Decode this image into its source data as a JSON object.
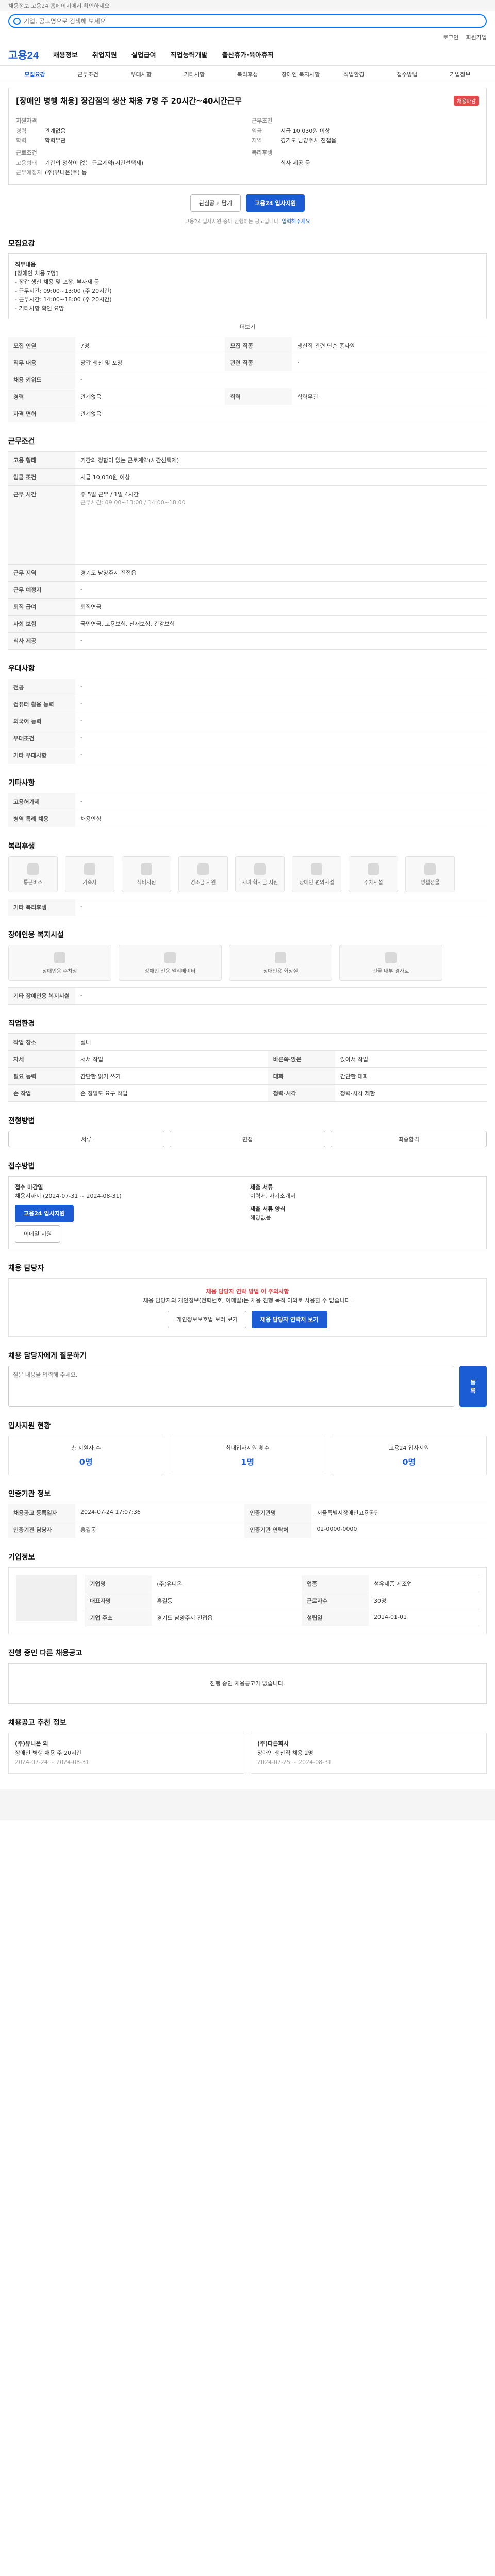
{
  "util": {
    "top": "채용정보 고용24 홈페이지에서 확인하세요",
    "login": "로그인",
    "join": "회원가입"
  },
  "search": {
    "placeholder": "기업, 공고명으로 검색해 보세요"
  },
  "gnb": {
    "logo": "고용24",
    "items": [
      "채용정보",
      "취업지원",
      "실업급여",
      "직업능력개발",
      "출산휴가·육아휴직"
    ]
  },
  "tabs": [
    "모집요강",
    "근무조건",
    "우대사항",
    "기타사항",
    "복리후생",
    "장애인 복지사항",
    "직업환경",
    "접수방법",
    "기업정보"
  ],
  "job": {
    "title": "[장애인 병행 채용] 장갑점의 생산 채용 7명 주 20시간~40시간근무",
    "badge": "채용마감",
    "left_label": "지원자격",
    "left": [
      [
        "경력",
        "관계없음"
      ],
      [
        "학력",
        "학력무관"
      ]
    ],
    "left2_label": "근로조건",
    "left2": [
      [
        "고용형태",
        "기간의 정함이 없는 근로계약(시간선택제)"
      ],
      [
        "근무예정지",
        "(주)유니온(주) 등"
      ]
    ],
    "right_label": "근무조건",
    "right": [
      [
        "임금",
        "시급 10,030원 이상"
      ],
      [
        "지역",
        "경기도 남양주시 진접읍"
      ]
    ],
    "right2_label": "복리후생",
    "right2": [
      [
        "",
        "식사 제공 등"
      ]
    ],
    "btn_like": "관심공고 담기",
    "btn_apply": "고용24 입사지원",
    "note": "고용24 입사지원 중이 진행하는 공고입니다.",
    "note_link": "입력해주세요"
  },
  "sec1": {
    "title": "모집요강",
    "desc_title": "직무내용",
    "desc": [
      "[장애인 채용 7명]",
      "- 장갑 생산 채용 및 포장, 부자재 등",
      "- 근무시간: 09:00~13:00 (주 20시간)",
      "- 근무시간: 14:00~18:00 (주 20시간)",
      "- 기타사항 확인 요망"
    ],
    "more": "더보기",
    "rows": [
      [
        "모집 인원",
        "7명",
        "모집 직종",
        "생산직 관련 단순 종사원"
      ],
      [
        "직무 내용",
        "장갑 생산 및 포장",
        "관련 직종",
        "-"
      ],
      [
        "채용 키워드",
        "-",
        "",
        ""
      ],
      [
        "경력",
        "관계없음",
        "학력",
        "학력무관"
      ],
      [
        "자격 면허",
        "관계없음",
        "",
        ""
      ]
    ]
  },
  "sec2": {
    "title": "근무조건",
    "rows": [
      [
        "고용 형태",
        "기간의 정함이 없는 근로계약(시간선택제)"
      ],
      [
        "임금 조건",
        "시급 10,030원 이상"
      ],
      [
        "근무 시간",
        "주 5일 근무 / 1일 4시간"
      ],
      [
        "근무 지역",
        "경기도 남양주시 진접읍"
      ],
      [
        "근무 예정지",
        "-"
      ],
      [
        "퇴직 급여",
        "퇴직연금"
      ],
      [
        "사회 보험",
        "국민연금, 고용보험, 산재보험, 건강보험"
      ],
      [
        "식사 제공",
        "-"
      ]
    ],
    "time_note": "근무시간: 09:00~13:00 / 14:00~18:00"
  },
  "sec3": {
    "title": "우대사항",
    "rows": [
      [
        "전공",
        "-"
      ],
      [
        "컴퓨터 활용 능력",
        "-"
      ],
      [
        "외국어 능력",
        "-"
      ],
      [
        "우대조건",
        "-"
      ],
      [
        "기타 우대사항",
        "-"
      ]
    ]
  },
  "sec4": {
    "title": "기타사항",
    "rows": [
      [
        "고용허가제",
        "-"
      ],
      [
        "병역 특례 채용",
        "채용안함"
      ]
    ]
  },
  "sec5": {
    "title": "복리후생",
    "items": [
      "통근버스",
      "기숙사",
      "식비지원",
      "경조금 지원",
      "자녀 학자금 지원",
      "장애인 편의시설",
      "주차시설",
      "명절선물"
    ],
    "extra_label": "기타 복리후생",
    "extra": "-"
  },
  "sec6": {
    "title": "장애인용 복지시설",
    "items": [
      "장애인용 주차장",
      "장애인 전용 엘리베이터",
      "장애인용 화장실",
      "건물 내부 경사로"
    ],
    "extra_label": "기타 장애인용 복지시설",
    "extra": "-"
  },
  "sec7": {
    "title": "직업환경",
    "rows": [
      [
        "작업 장소",
        "실내",
        "",
        ""
      ],
      [
        "자세",
        "서서 작업",
        "바른쪽·앉은",
        "앉아서 작업"
      ],
      [
        "필요 능력",
        "간단한 읽기 쓰기",
        "대화",
        "간단한 대화"
      ],
      [
        "손 작업",
        "손 정밀도 요구 작업",
        "청력·시각",
        "청력·시각 제한"
      ]
    ]
  },
  "sec8": {
    "title": "전형방법",
    "steps": [
      "서류",
      "면접",
      "최종합격"
    ]
  },
  "sec9": {
    "title": "접수방법",
    "period_label": "접수 마감일",
    "period": "채용시까지 (2024-07-31 ~ 2024-08-31)",
    "apply_btn": "고용24 입사지원",
    "email_btn": "이메일 지원",
    "how_label": "제출 서류",
    "docs": "이력서, 자기소개서",
    "forms_label": "제출 서류 양식",
    "forms": "해당없음"
  },
  "sec10": {
    "title": "채용 담당자",
    "warn_title": "채용 담당자 연락 방법 이 주의사항",
    "warn": "채용 담당자의 개인정보(전화번호, 이메일)는 채용 진행 목적 이외로 사용할 수 없습니다.",
    "btn1": "개인정보보호법 보러 보기",
    "btn2": "채용 담당자 연락처 보기"
  },
  "sec11": {
    "title": "채용 담당자에게 질문하기",
    "placeholder": "질문 내용을 입력해 주세요.",
    "submit": "등록"
  },
  "sec12": {
    "title": "입사지원 현황",
    "stats": [
      [
        "총 지원자 수",
        "0명"
      ],
      [
        "최대입사지원 횟수",
        "1명"
      ],
      [
        "고용24 입사지원",
        "0명"
      ]
    ]
  },
  "sec13": {
    "title": "인증기관 정보",
    "rows": [
      [
        "채용공고 등록일자",
        "2024-07-24 17:07:36",
        "인증기관명",
        "서울특별시장애인고용공단"
      ],
      [
        "인증기관 담당자",
        "홍길동",
        "인증기관 연락처",
        "02-0000-0000"
      ]
    ]
  },
  "sec14": {
    "title": "기업정보",
    "rows": [
      [
        "기업명",
        "(주)유니온",
        "업종",
        "섬유제품 제조업"
      ],
      [
        "대표자명",
        "홍길동",
        "근로자수",
        "30명"
      ],
      [
        "기업 주소",
        "경기도 남양주시 진접읍",
        "설립일",
        "2014-01-01"
      ]
    ]
  },
  "sec15": {
    "title": "진행 중인 다른 채용공고",
    "empty": "진행 중인 채용공고가 없습니다."
  },
  "sec16": {
    "title": "채용공고 추천 정보",
    "items": [
      [
        "(주)유니온 외",
        "장애인 병행 채용 주 20시간",
        "2024-07-24 ~ 2024-08-31"
      ],
      [
        "(주)다른회사",
        "장애인 생산직 채용 2명",
        "2024-07-25 ~ 2024-08-31"
      ]
    ]
  }
}
